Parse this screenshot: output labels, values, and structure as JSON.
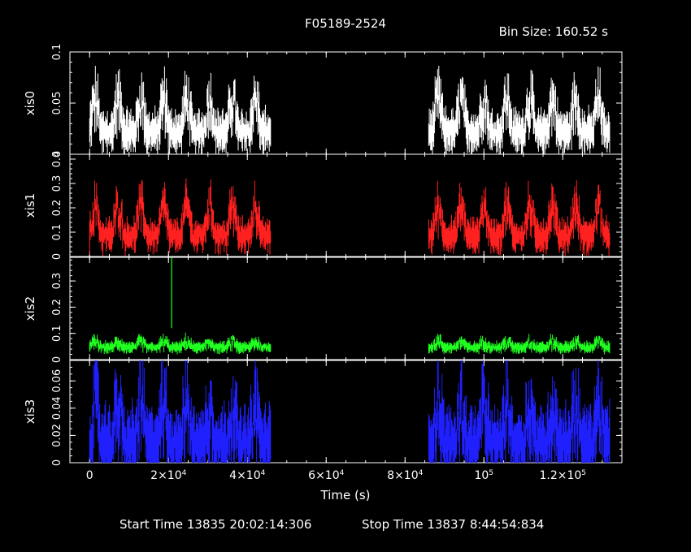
{
  "title": "F05189-2524",
  "bin_size_label": "Bin Size:  160.52  s",
  "footer": {
    "start": "Start Time 13835 20:02:14:306",
    "stop": "Stop Time 13837  8:44:54:834"
  },
  "chart_data": {
    "type": "line",
    "xlabel": "Time (s)",
    "xlim": [
      -5000,
      135000
    ],
    "x_ticks": [
      {
        "v": 0,
        "html": "0"
      },
      {
        "v": 20000,
        "html": "2×10<tspan baseline-shift=\"super\" font-size=\"9\">4</tspan>"
      },
      {
        "v": 40000,
        "html": "4×10<tspan baseline-shift=\"super\" font-size=\"9\">4</tspan>"
      },
      {
        "v": 60000,
        "html": "6×10<tspan baseline-shift=\"super\" font-size=\"9\">4</tspan>"
      },
      {
        "v": 80000,
        "html": "8×10<tspan baseline-shift=\"super\" font-size=\"9\">4</tspan>"
      },
      {
        "v": 100000,
        "html": "10<tspan baseline-shift=\"super\" font-size=\"9\">5</tspan>"
      },
      {
        "v": 120000,
        "html": "1.2×10<tspan baseline-shift=\"super\" font-size=\"9\">5</tspan>"
      }
    ],
    "x_minor_step": 5000,
    "data_segments": [
      [
        0,
        46000
      ],
      [
        86000,
        132000
      ]
    ],
    "series": [
      {
        "name": "xis0",
        "color": "#ffffff",
        "ylim": [
          0,
          0.1
        ],
        "yticks": [
          0,
          0.05,
          0.1
        ],
        "ytick_labels": [
          "0",
          "0.05",
          "0.1"
        ],
        "minor": 0.01,
        "base": 0.02,
        "amp": 0.026,
        "spread": 0.028,
        "spikes": []
      },
      {
        "name": "xis1",
        "color": "#ff2020",
        "ylim": [
          0,
          0.42
        ],
        "yticks": [
          0,
          0.1,
          0.2,
          0.3,
          0.4
        ],
        "ytick_labels": [
          "0",
          "0.1",
          "0.2",
          "0.3",
          "0.4"
        ],
        "minor": 0.02,
        "base": 0.08,
        "amp": 0.1,
        "spread": 0.09,
        "spikes": []
      },
      {
        "name": "xis2",
        "color": "#20ff20",
        "ylim": [
          0,
          0.39
        ],
        "yticks": [
          0,
          0.1,
          0.2,
          0.3
        ],
        "ytick_labels": [
          "0",
          "0.1",
          "0.2",
          "0.3"
        ],
        "minor": 0.02,
        "base": 0.045,
        "amp": 0.015,
        "spread": 0.028,
        "spikes": [
          {
            "x": 20800,
            "y0": 0.12,
            "y1": 0.39
          }
        ]
      },
      {
        "name": "xis3",
        "color": "#2020ff",
        "ylim": [
          0,
          0.075
        ],
        "yticks": [
          0,
          0.02,
          0.04,
          0.06
        ],
        "ytick_labels": [
          "0",
          "0.02",
          "0.04",
          "0.06"
        ],
        "minor": 0.005,
        "base": 0.012,
        "amp": 0.02,
        "spread": 0.035,
        "spikes": []
      }
    ]
  }
}
